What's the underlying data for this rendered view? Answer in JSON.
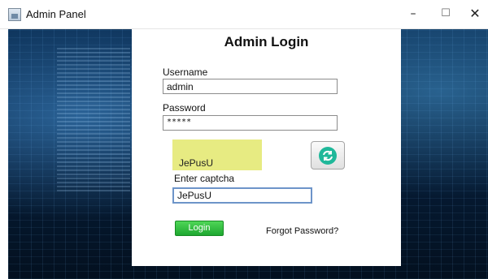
{
  "window": {
    "title": "Admin Panel",
    "minimize": "–",
    "maximize": "☐",
    "close": "✕"
  },
  "login": {
    "heading": "Admin Login",
    "username_label": "Username",
    "username_value": "admin",
    "password_label": "Password",
    "password_value": "*****",
    "captcha_text": "JePusU",
    "captcha_label": "Enter captcha",
    "captcha_value": "JePusU",
    "login_button": "Login",
    "forgot_password": "Forgot Password?"
  },
  "icons": {
    "app": "app-window-icon",
    "refresh": "refresh-icon"
  },
  "colors": {
    "captcha_bg": "#e7eb82",
    "login_button": "#2bbf3c",
    "refresh_icon": "#1fb89a",
    "background": "#0b2f55"
  }
}
